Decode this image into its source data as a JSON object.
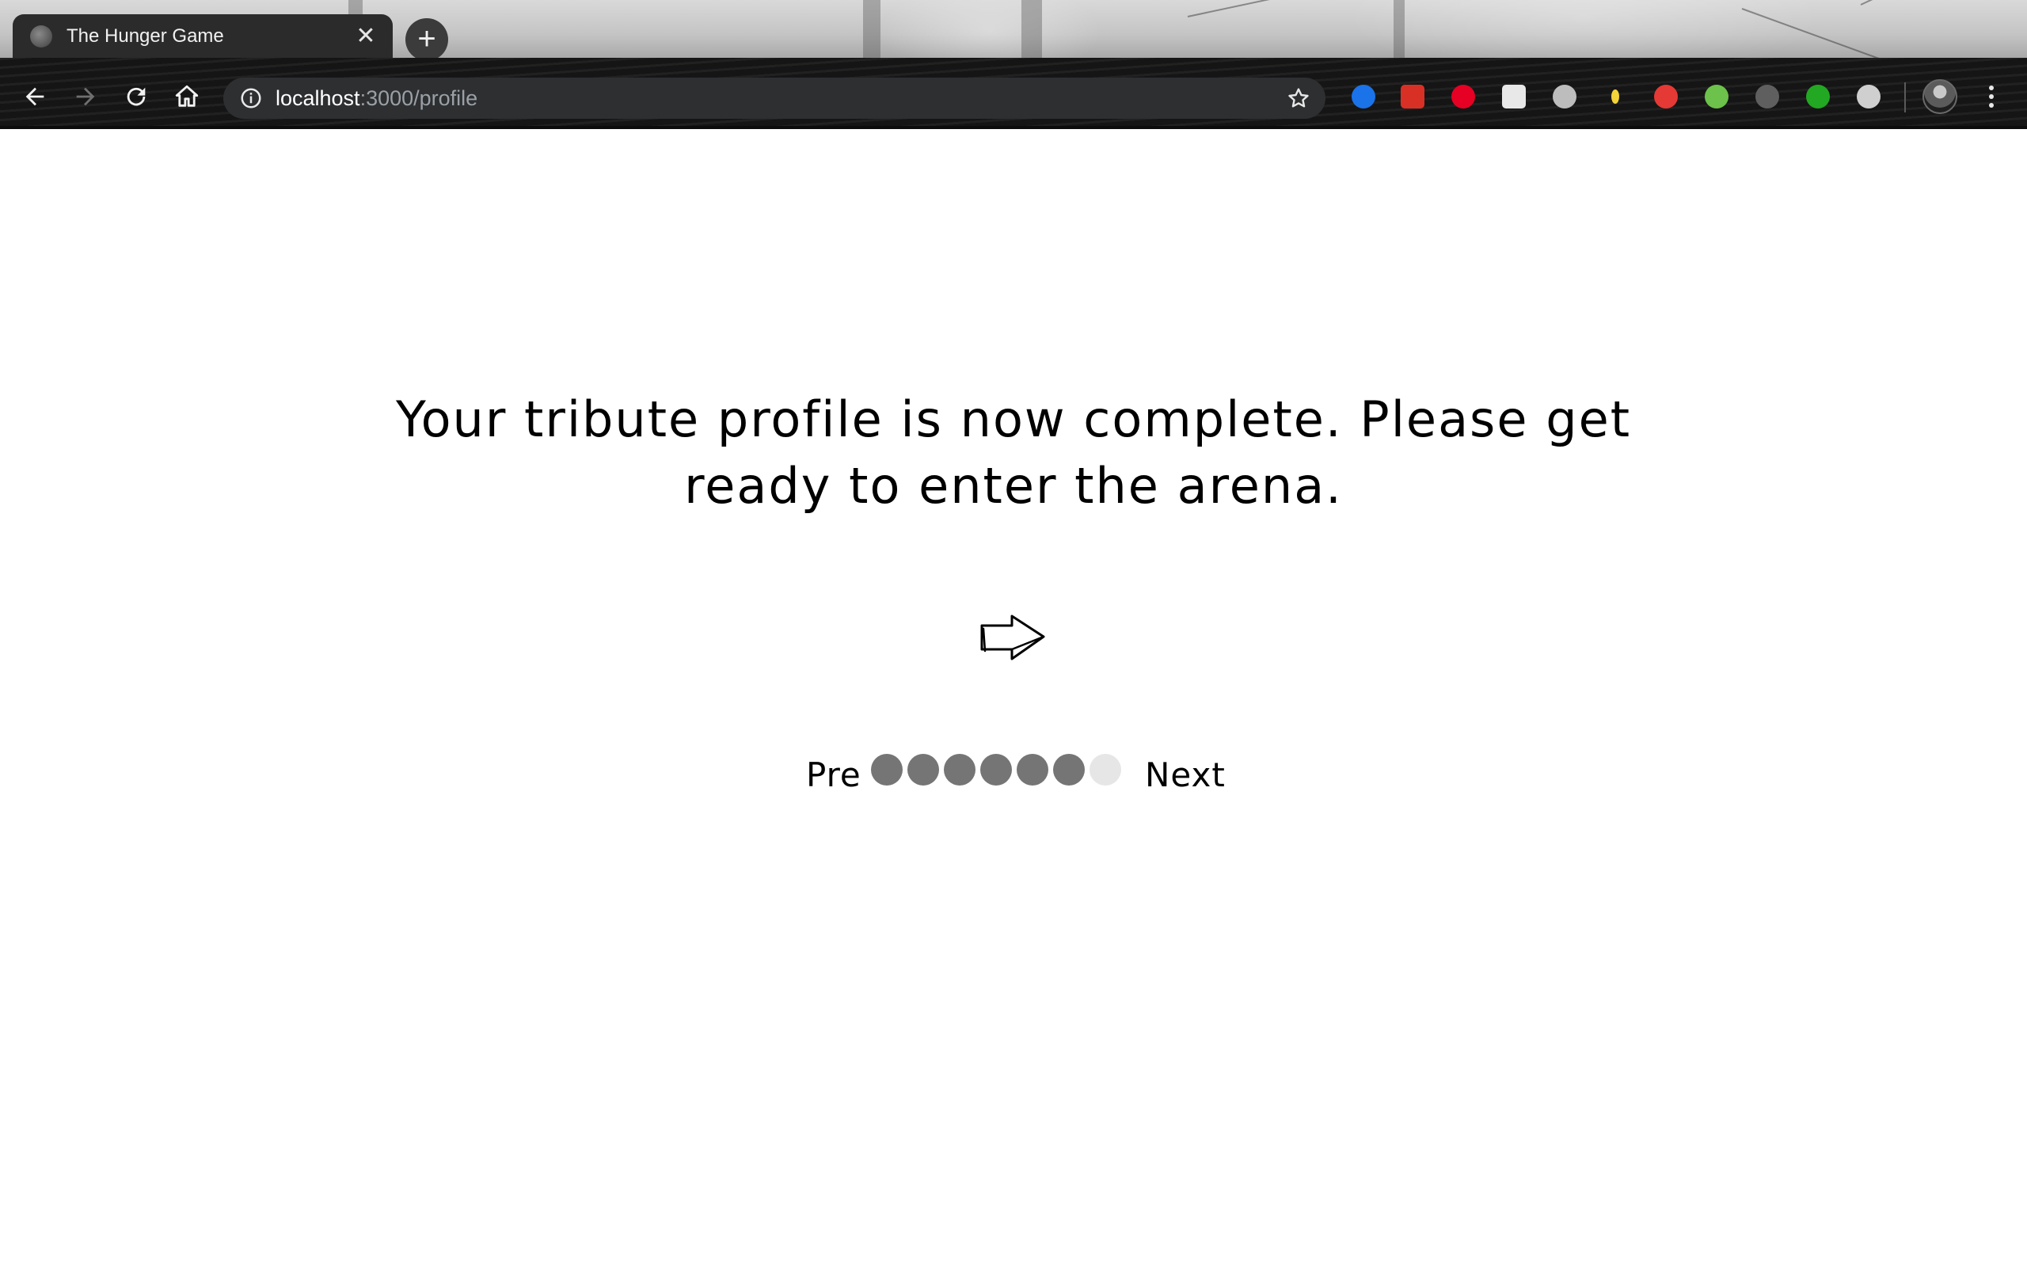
{
  "browser": {
    "tab": {
      "title": "The Hunger Game",
      "favicon": "page-favicon"
    },
    "new_tab_icon": "plus-icon",
    "nav": {
      "back": "back-arrow-icon",
      "forward": "forward-arrow-icon",
      "reload": "reload-icon",
      "home": "home-icon"
    },
    "address": {
      "host": "localhost",
      "path": ":3000/profile"
    },
    "extensions": [
      {
        "name": "museum-extension-icon",
        "color": "#1a73e8"
      },
      {
        "name": "book-extension-icon",
        "color": "#d93025"
      },
      {
        "name": "pinterest-icon",
        "color": "#e60023"
      },
      {
        "name": "pocket-icon",
        "color": "#e8e8e8"
      },
      {
        "name": "camera-icon",
        "color": "#bdbdbd"
      },
      {
        "name": "lightbulb-icon",
        "color": "#f2d43a"
      },
      {
        "name": "hand-stop-icon",
        "color": "#e53935"
      },
      {
        "name": "nodejs-icon",
        "color": "#6cc24a"
      },
      {
        "name": "gauge-icon",
        "color": "#5f5f5f"
      },
      {
        "name": "shield-icon",
        "color": "#22a822"
      },
      {
        "name": "lens-icon",
        "color": "#cfcfcf"
      }
    ]
  },
  "page": {
    "message": "Your tribute profile is now complete. Please get ready to enter the arena.",
    "arrow_icon": "next-arrow-icon",
    "pagination": {
      "pre_label": "Pre",
      "next_label": "Next",
      "total_steps": 7,
      "completed_steps": 6,
      "active_color": "#757575",
      "inactive_color": "#e6e6e6"
    }
  }
}
